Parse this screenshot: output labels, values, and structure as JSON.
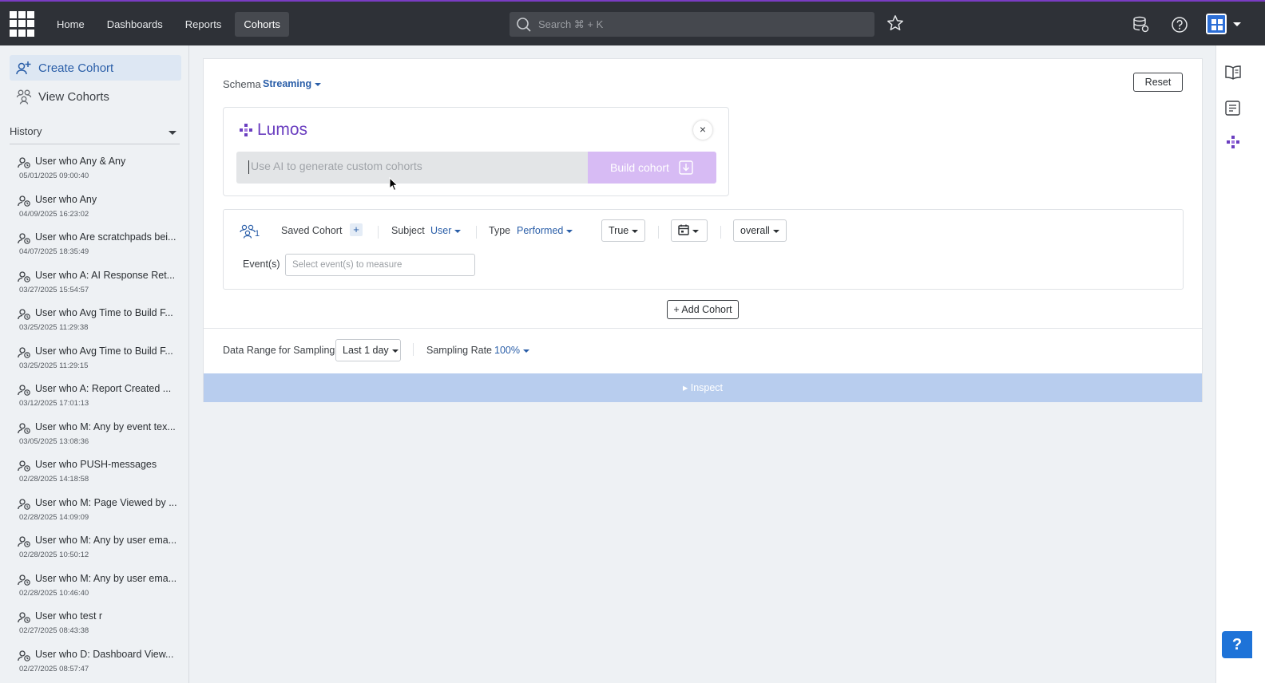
{
  "nav": {
    "items": [
      {
        "label": "Home",
        "active": false
      },
      {
        "label": "Dashboards",
        "active": false
      },
      {
        "label": "Reports",
        "active": false
      },
      {
        "label": "Cohorts",
        "active": true
      }
    ],
    "search_placeholder": "Search ⌘ + K"
  },
  "sidebar": {
    "create_label": "Create Cohort",
    "view_label": "View Cohorts",
    "history_label": "History",
    "history": [
      {
        "title": "User who Any & Any",
        "date": "05/01/2025 09:00:40"
      },
      {
        "title": "User who Any",
        "date": "04/09/2025 16:23:02"
      },
      {
        "title": "User who Are scratchpads bei...",
        "date": "04/07/2025 18:35:49"
      },
      {
        "title": "User who A: AI Response Ret...",
        "date": "03/27/2025 15:54:57"
      },
      {
        "title": "User who Avg Time to Build F...",
        "date": "03/25/2025 11:29:38"
      },
      {
        "title": "User who Avg Time to Build F...",
        "date": "03/25/2025 11:29:15"
      },
      {
        "title": "User who A: Report Created ...",
        "date": "03/12/2025 17:01:13"
      },
      {
        "title": "User who M: Any by event tex...",
        "date": "03/05/2025 13:08:36"
      },
      {
        "title": "User who PUSH-messages",
        "date": "02/28/2025 14:18:58"
      },
      {
        "title": "User who M: Page Viewed by ...",
        "date": "02/28/2025 14:09:09"
      },
      {
        "title": "User who M: Any by user ema...",
        "date": "02/28/2025 10:50:12"
      },
      {
        "title": "User who M: Any by user ema...",
        "date": "02/28/2025 10:46:40"
      },
      {
        "title": "User who test r",
        "date": "02/27/2025 08:43:38"
      },
      {
        "title": "User who D: Dashboard View...",
        "date": "02/27/2025 08:57:47"
      }
    ]
  },
  "main": {
    "schema_label": "Schema",
    "schema_value": "Streaming",
    "reset_label": "Reset",
    "lumos": {
      "title": "Lumos",
      "close": "×",
      "placeholder": "Use AI to generate custom cohorts",
      "build_label": "Build cohort"
    },
    "cohort": {
      "count": "1",
      "saved_label": "Saved Cohort",
      "plus": "+",
      "subject_label": "Subject",
      "subject_value": "User",
      "type_label": "Type",
      "type_value": "Performed",
      "truth_value": "True",
      "overall_value": "overall",
      "events_label": "Event(s)",
      "events_placeholder": "Select event(s) to measure"
    },
    "add_cohort_label": "+ Add Cohort",
    "sampling": {
      "range_label": "Data Range for Sampling",
      "range_value": "Last 1 day",
      "rate_label": "Sampling Rate",
      "rate_value": "100%"
    },
    "inspect_label": "▸ Inspect"
  },
  "help_fab": "?",
  "colors": {
    "topbar": "#2e3137",
    "accent_purple": "#6b3fc0",
    "link_blue": "#2a5ea8",
    "inspect_bar": "#b8cdee"
  }
}
